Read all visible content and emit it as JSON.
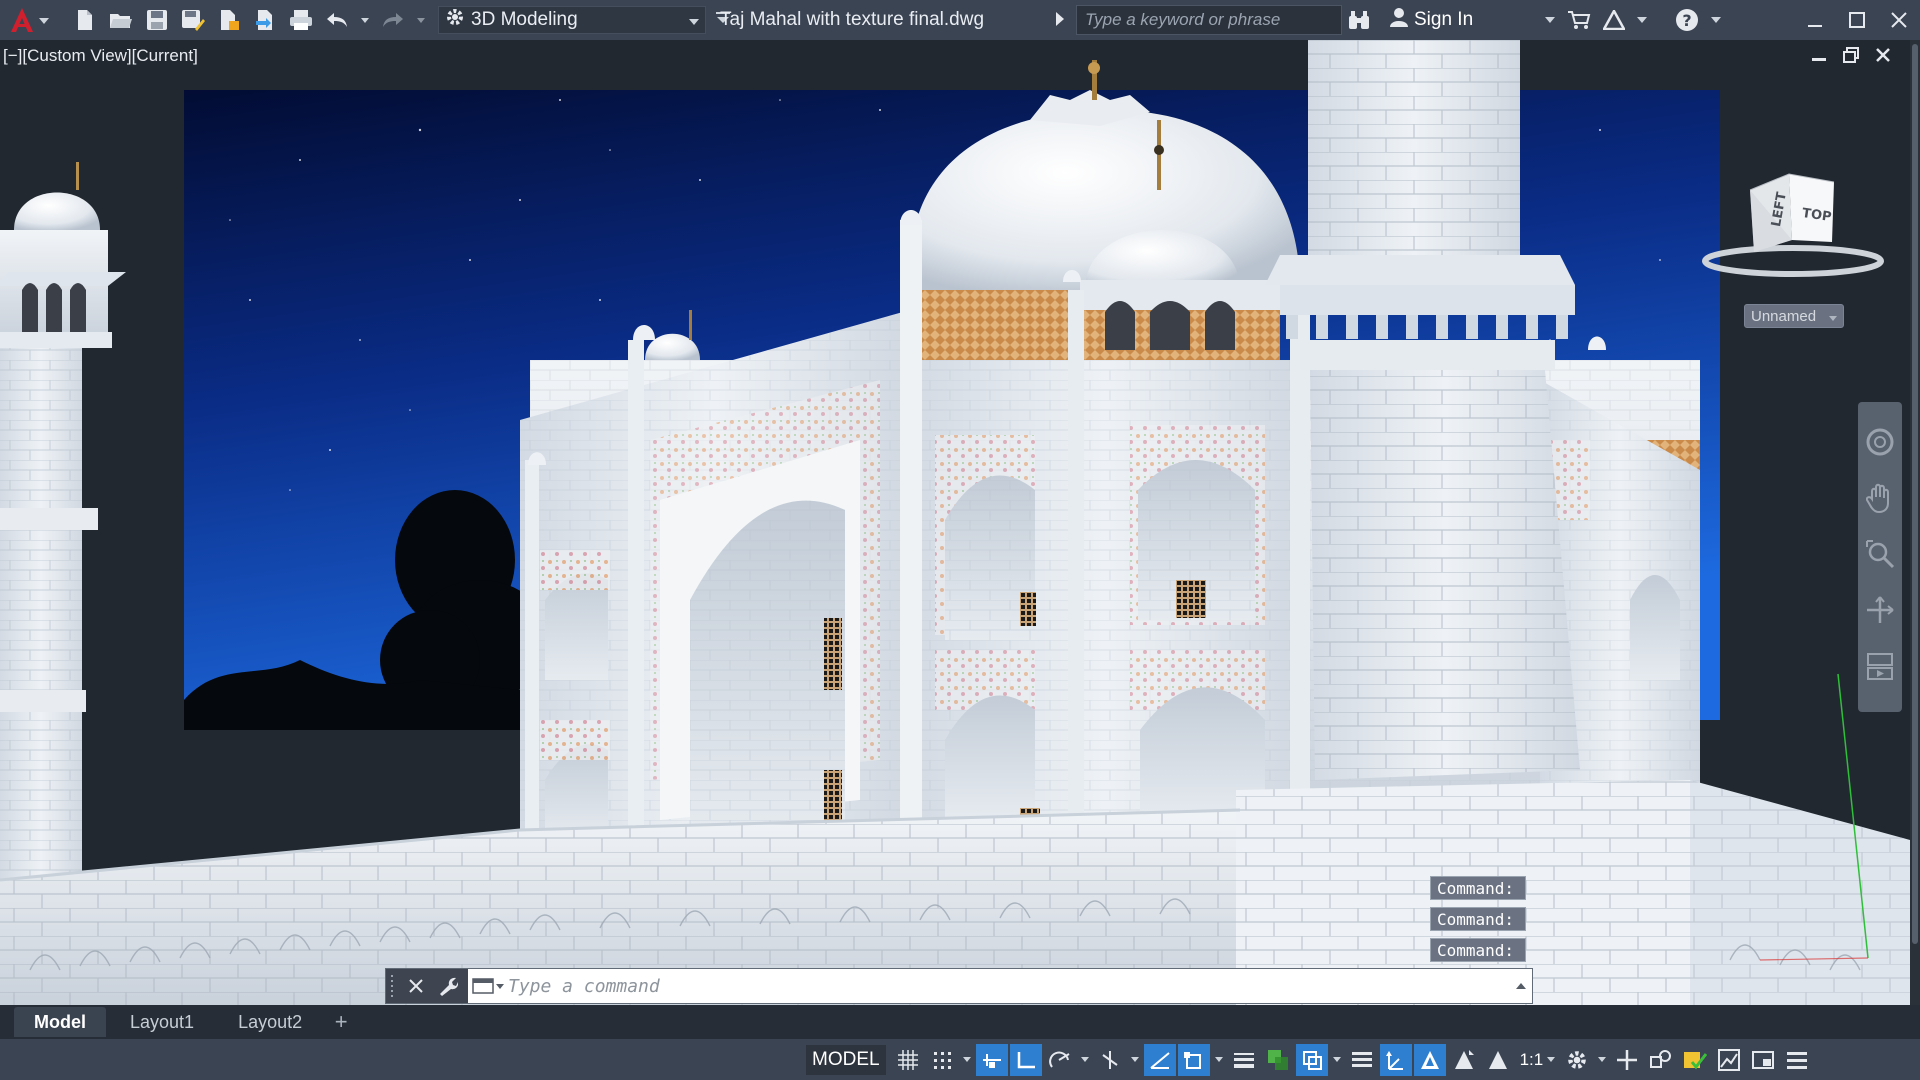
{
  "app": {
    "document_title": "Taj Mahal with texture final.dwg",
    "workspace": "3D Modeling",
    "search_placeholder": "Type a keyword or phrase",
    "sign_in": "Sign In"
  },
  "viewport": {
    "view_label": "[−][Custom View][Current]",
    "viewcube_faces": [
      "LEFT",
      "TOP"
    ],
    "named_view": "Unnamed"
  },
  "command": {
    "history": [
      "Command:",
      "Command:",
      "Command:"
    ],
    "placeholder": "Type a command"
  },
  "layout_tabs": [
    {
      "label": "Model",
      "active": true
    },
    {
      "label": "Layout1",
      "active": false
    },
    {
      "label": "Layout2",
      "active": false
    }
  ],
  "status": {
    "model": "MODEL",
    "scale": "1:1"
  },
  "colors": {
    "titlebar": "#3b4453",
    "accent": "#2f7fd0",
    "logo_red": "#d11f2e",
    "sky_top": "#03113a",
    "sky_bottom": "#1a63d8",
    "marble": "#e9eef3"
  },
  "icons": {
    "qat": [
      "new-icon",
      "open-icon",
      "save-icon",
      "save-as-icon",
      "open-from-web-icon",
      "save-to-web-icon",
      "plot-icon",
      "undo-icon",
      "redo-icon"
    ],
    "status": [
      "grid-icon",
      "snap-icon",
      "infer-icon",
      "ortho-icon",
      "polar-icon",
      "isodraft-icon",
      "osnap-track-icon",
      "osnap-icon",
      "lineweight-icon",
      "transparency-icon",
      "selection-cycling-icon",
      "3d-osnap-icon",
      "dynamic-ucs-icon",
      "annotation-visibility-icon",
      "auto-scale-icon",
      "annotation-scale-icon",
      "workspace-gear-icon",
      "annotation-monitor-icon",
      "isolate-icon",
      "hardware-accel-icon",
      "graphics-perf-icon",
      "clean-screen-icon",
      "customize-icon"
    ]
  }
}
